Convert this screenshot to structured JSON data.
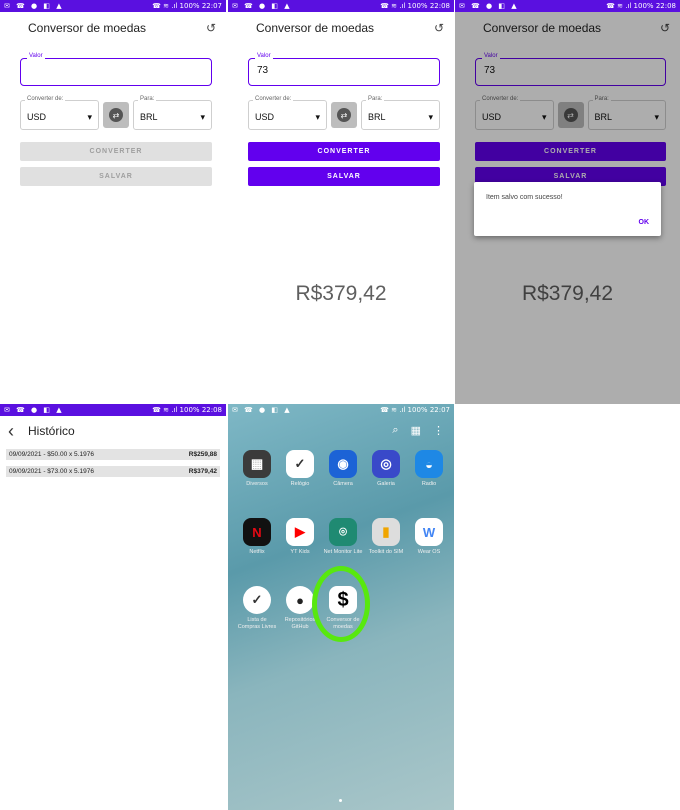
{
  "status": {
    "left_icons": "✉ ☎ ● ◧ ▲",
    "right_prefix": "☎ ≋ .ıl 100%",
    "times": [
      "22:07",
      "22:08",
      "22:08",
      "22:08",
      "22:07"
    ]
  },
  "app": {
    "title": "Conversor de moedas",
    "history_icon": "history-icon",
    "value_label": "Valor",
    "from_label": "Converter de:",
    "to_label": "Para:",
    "from_value": "USD",
    "to_value": "BRL",
    "convert_label": "CONVERTER",
    "save_label": "SALVAR",
    "input_empty": "",
    "input_value": "73",
    "result": "R$379,42",
    "dialog_message": "Item salvo com sucesso!",
    "dialog_ok": "OK"
  },
  "history": {
    "title": "Histórico",
    "rows": [
      {
        "desc": "09/09/2021  -  $50.00 x 5.1976",
        "amount": "R$259,88"
      },
      {
        "desc": "09/09/2021  -  $73.00 x 5.1976",
        "amount": "R$379,42"
      }
    ]
  },
  "home": {
    "apps": [
      {
        "label": "Diversos",
        "icon": "folder-icon",
        "color": "#3b3b3b"
      },
      {
        "label": "Relógio",
        "icon": "clock-icon",
        "color": "#ffffff"
      },
      {
        "label": "Câmera",
        "icon": "camera-icon",
        "color": "#1c63d6"
      },
      {
        "label": "Galeria",
        "icon": "balloon-icon",
        "color": "#3949c9"
      },
      {
        "label": "Radio",
        "icon": "wave-icon",
        "color": "#1e88e5"
      },
      {
        "label": "Netflix",
        "icon": "netflix-icon",
        "color": "#111111"
      },
      {
        "label": "YT Kids",
        "icon": "youtube-icon",
        "color": "#ffffff"
      },
      {
        "label": "Net Monitor Lite",
        "icon": "antenna-icon",
        "color": "#1f8a72"
      },
      {
        "label": "Toolkit do SIM",
        "icon": "sim-icon",
        "color": "#dddddd"
      },
      {
        "label": "Wear OS",
        "icon": "wear-icon",
        "color": "#ffffff"
      },
      {
        "label": "Lista de Compras Livres",
        "icon": "checklist-icon",
        "color": "#ffffff"
      },
      {
        "label": "Repositórios GitHub",
        "icon": "github-icon",
        "color": "#ffffff"
      },
      {
        "label": "Conversor de moedas",
        "icon": "dollar-icon",
        "color": "#ffffff"
      }
    ]
  }
}
